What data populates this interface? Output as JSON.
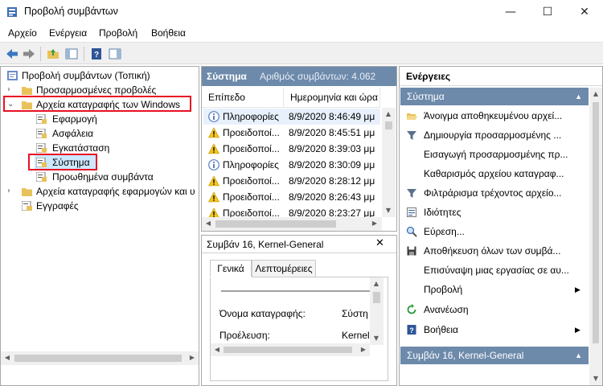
{
  "window": {
    "title": "Προβολή συμβάντων",
    "controls": {
      "minimize": "—",
      "maximize": "☐",
      "close": "✕"
    }
  },
  "menu": [
    "Αρχείο",
    "Ενέργεια",
    "Προβολή",
    "Βοήθεια"
  ],
  "tree": {
    "root": "Προβολή συμβάντων (Τοπική)",
    "custom_views": "Προσαρμοσμένες προβολές",
    "windows_logs": "Αρχεία καταγραφής των Windows",
    "app": "Εφαρμογή",
    "security": "Ασφάλεια",
    "setup": "Εγκατάσταση",
    "system": "Σύστημα",
    "forwarded": "Προωθημένα συμβάντα",
    "apps_services": "Αρχεία καταγραφής εφαρμογών και υ",
    "subscriptions": "Εγγραφές"
  },
  "events_pane": {
    "title": "Σύστημα",
    "count_label": "Αριθμός συμβάντων: 4.062",
    "columns": [
      "Επίπεδο",
      "Ημερομηνία και ώρα"
    ],
    "rows": [
      {
        "level": "Πληροφορίες",
        "date": "8/9/2020 8:46:49 μμ",
        "icon": "info"
      },
      {
        "level": "Προειδοποί...",
        "date": "8/9/2020 8:45:51 μμ",
        "icon": "warning"
      },
      {
        "level": "Προειδοποί...",
        "date": "8/9/2020 8:39:03 μμ",
        "icon": "warning"
      },
      {
        "level": "Πληροφορίες",
        "date": "8/9/2020 8:30:09 μμ",
        "icon": "info"
      },
      {
        "level": "Προειδοποί...",
        "date": "8/9/2020 8:28:12 μμ",
        "icon": "warning"
      },
      {
        "level": "Προειδοποί...",
        "date": "8/9/2020 8:26:43 μμ",
        "icon": "warning"
      },
      {
        "level": "Προειδοποί...",
        "date": "8/9/2020 8:23:27 μμ",
        "icon": "warning"
      }
    ]
  },
  "detail": {
    "title": "Συμβάν 16, Kernel-General",
    "close": "✕",
    "tabs": [
      "Γενικά",
      "Λεπτομέρειες"
    ],
    "fields": [
      {
        "label": "Όνομα καταγραφής:",
        "value": "Σύστη"
      },
      {
        "label": "Προέλευση:",
        "value": "Kernel-"
      }
    ]
  },
  "actions": {
    "header": "Ενέργειες",
    "section1": "Σύστημα",
    "items": [
      {
        "label": "Άνοιγμα αποθηκευμένου αρχεί...",
        "icon": "folder-open-icon"
      },
      {
        "label": "Δημιουργία προσαρμοσμένης ...",
        "icon": "filter-icon"
      },
      {
        "label": "Εισαγωγή προσαρμοσμένης πρ...",
        "icon": ""
      },
      {
        "label": "Καθαρισμός αρχείου καταγραφ...",
        "icon": ""
      },
      {
        "label": "Φιλτράρισμα τρέχοντος αρχείο...",
        "icon": "filter-icon"
      },
      {
        "label": "Ιδιότητες",
        "icon": "properties-icon"
      },
      {
        "label": "Εύρεση...",
        "icon": "find-icon"
      },
      {
        "label": "Αποθήκευση όλων των συμβά...",
        "icon": "save-icon"
      },
      {
        "label": "Επισύναψη μιας εργασίας σε αυ...",
        "icon": ""
      },
      {
        "label": "Προβολή",
        "icon": ""
      },
      {
        "label": "Ανανέωση",
        "icon": "refresh-icon"
      },
      {
        "label": "Βοήθεια",
        "icon": "help-icon"
      }
    ],
    "section2": "Συμβάν 16, Kernel-General"
  },
  "colors": {
    "header_blue": "#6d8aab",
    "highlight_red": "#e81123",
    "warning_yellow": "#f5c518",
    "info_blue": "#5a7fc7"
  }
}
